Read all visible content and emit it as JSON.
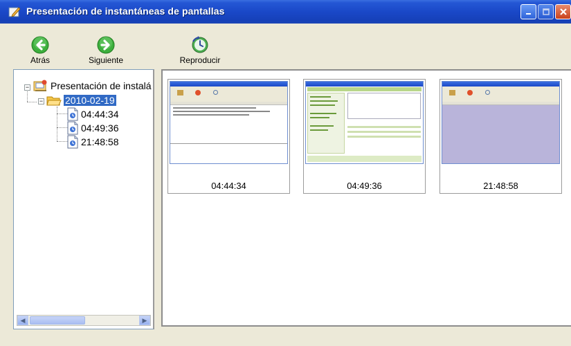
{
  "window": {
    "title": "Presentación de instantáneas de pantallas",
    "colors": {
      "title_bar": "#1A48C8",
      "close_button": "#C9421B",
      "selection": "#316AC5"
    }
  },
  "toolbar": {
    "back_label": "Atrás",
    "next_label": "Siguiente",
    "play_label": "Reproducir"
  },
  "tree": {
    "root_label": "Presentación de instalá",
    "date_label": "2010-02-19",
    "items": [
      {
        "label": "04:44:34"
      },
      {
        "label": "04:49:36"
      },
      {
        "label": "21:48:58"
      }
    ]
  },
  "thumbnails": [
    {
      "caption": "04:44:34"
    },
    {
      "caption": "04:49:36"
    },
    {
      "caption": "21:48:58"
    }
  ]
}
